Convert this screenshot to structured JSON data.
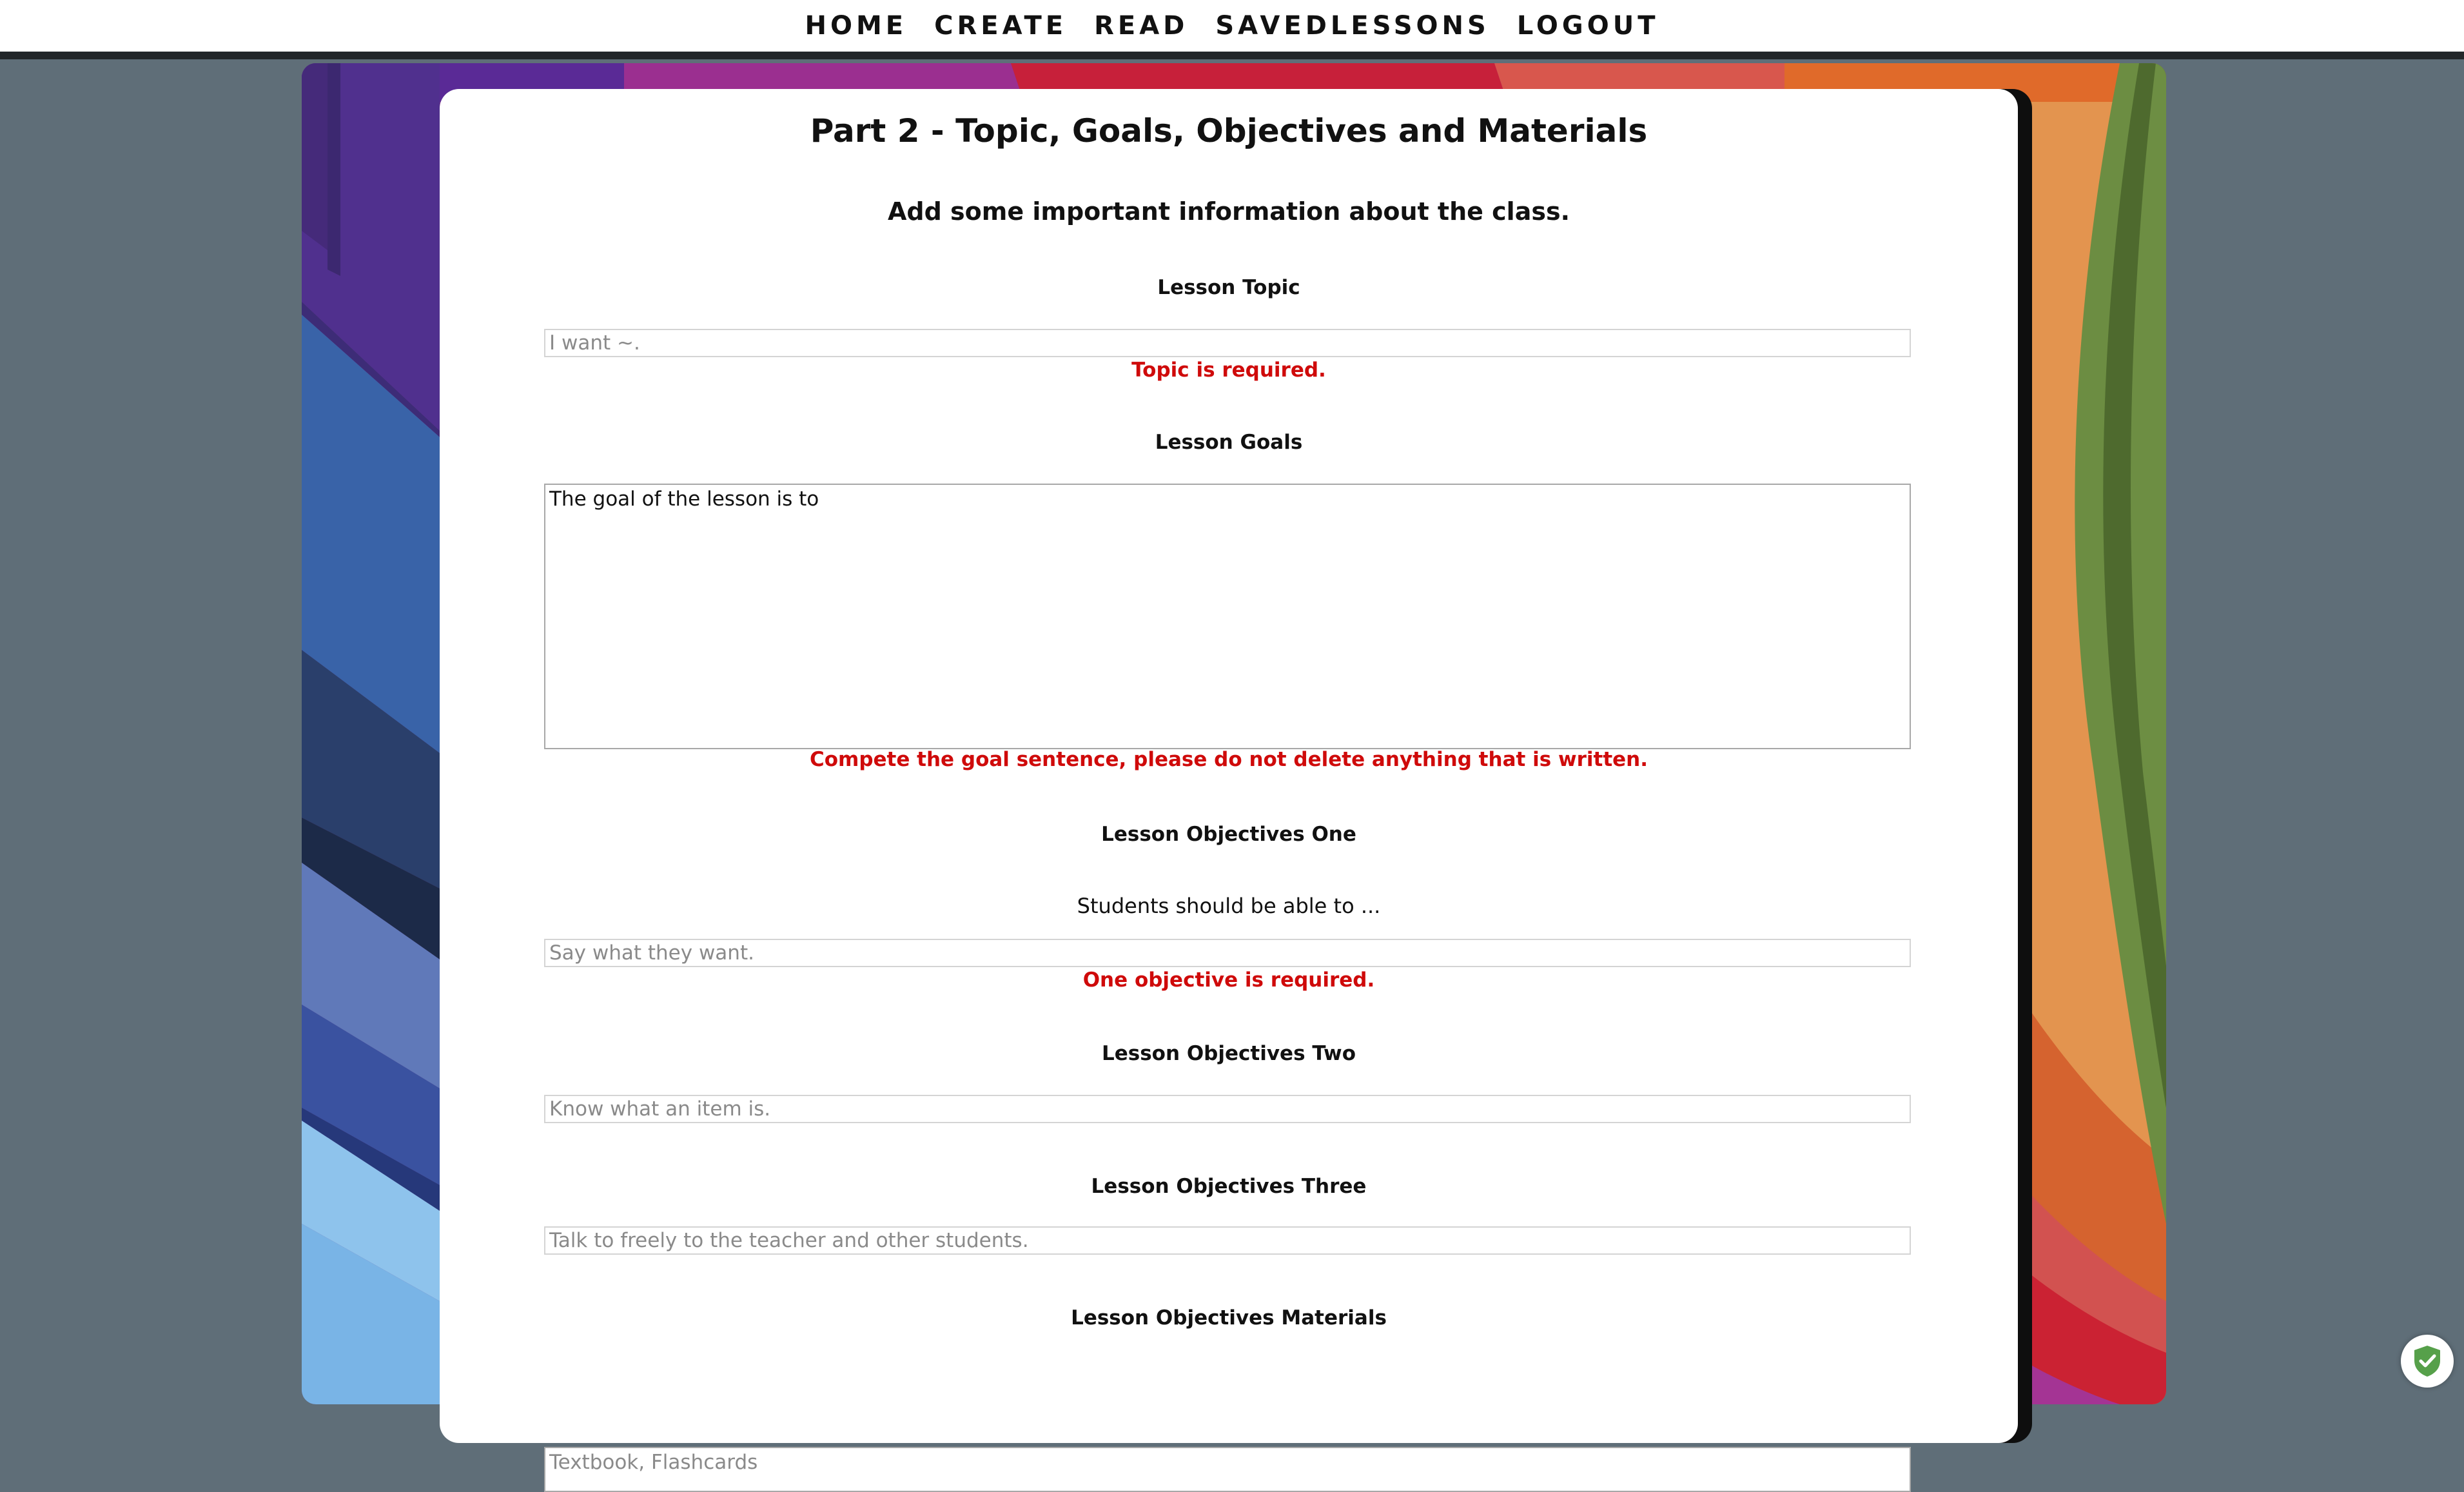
{
  "nav": {
    "items": [
      {
        "label": "HOME"
      },
      {
        "label": "CREATE"
      },
      {
        "label": "READ"
      },
      {
        "label": "SAVEDLESSONS"
      },
      {
        "label": "LOGOUT"
      }
    ]
  },
  "form": {
    "title": "Part 2 - Topic, Goals, Objectives and Materials",
    "subtitle": "Add some important information about the class.",
    "topic": {
      "label": "Lesson Topic",
      "placeholder": "I want ~.",
      "value": "",
      "error": "Topic is required."
    },
    "goals": {
      "label": "Lesson Goals",
      "value": "The goal of the lesson is to",
      "error": "Compete the goal sentence, please do not delete anything that is written."
    },
    "objective_one": {
      "label": "Lesson Objectives One",
      "hint": "Students should be able to ...",
      "placeholder": "Say what they want.",
      "error": "One objective is required."
    },
    "objective_two": {
      "label": "Lesson Objectives Two",
      "placeholder": "Know what an item is."
    },
    "objective_three": {
      "label": "Lesson Objectives Three",
      "placeholder": "Talk to freely to the teacher and other students."
    },
    "materials": {
      "label": "Lesson Objectives Materials",
      "placeholder": "Textbook, Flashcards"
    }
  },
  "colors": {
    "error": "#cf0a0a",
    "page_background": "#5f6e78",
    "nav_border": "#222629"
  },
  "widgets": {
    "security_badge_icon": "shield-check-icon"
  }
}
